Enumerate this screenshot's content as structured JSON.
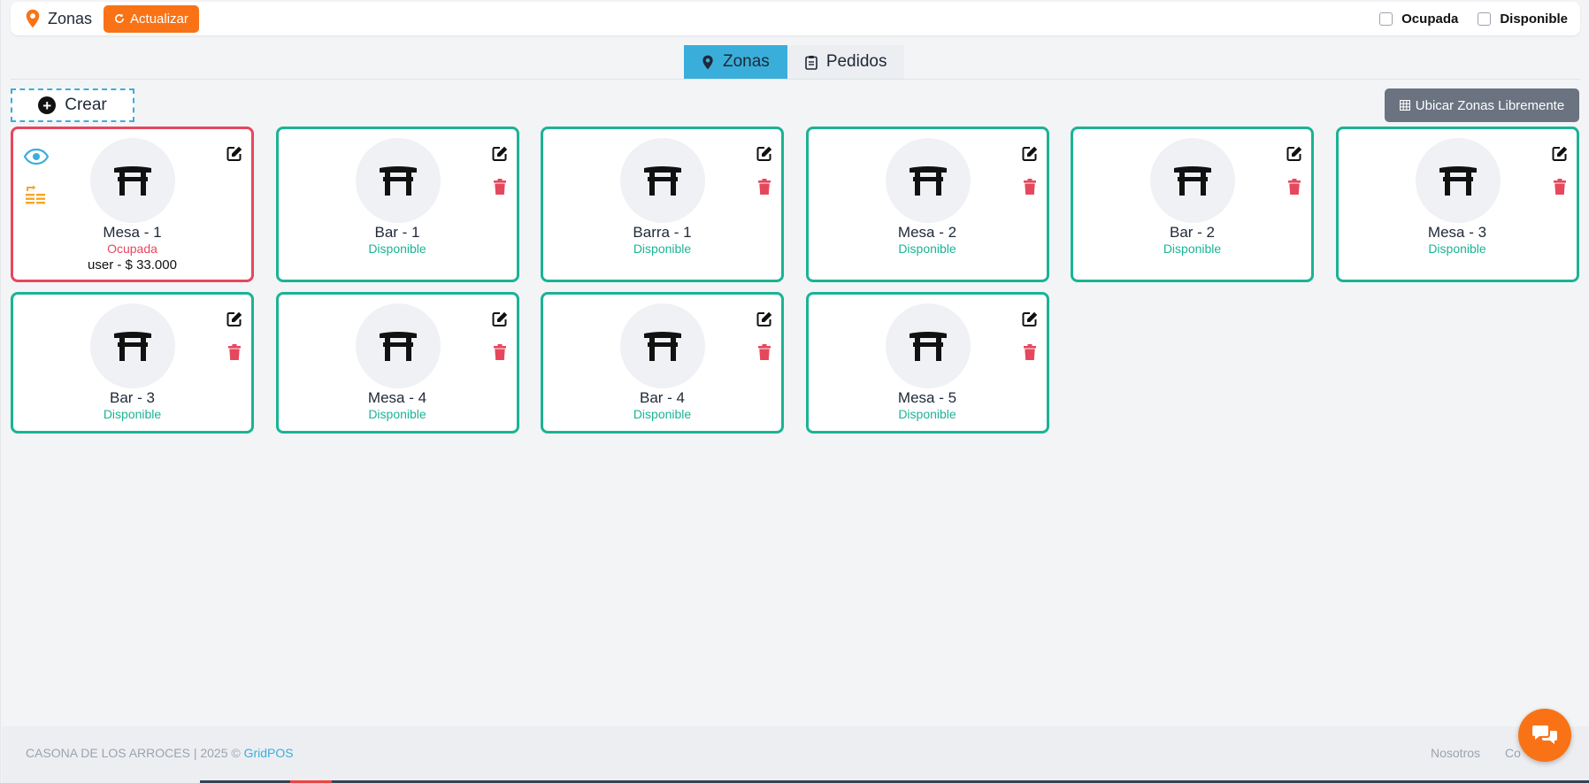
{
  "header": {
    "title": "Zonas",
    "refresh_label": "Actualizar",
    "filters": [
      {
        "label": "Ocupada",
        "checked": false
      },
      {
        "label": "Disponible",
        "checked": false
      }
    ]
  },
  "tabs": [
    {
      "label": "Zonas",
      "active": true
    },
    {
      "label": "Pedidos",
      "active": false
    }
  ],
  "actions": {
    "create_label": "Crear",
    "locate_label": "Ubicar Zonas Libremente"
  },
  "zones": [
    {
      "name": "Mesa - 1",
      "status": "Ocupada",
      "order": "user - $ 33.000"
    },
    {
      "name": "Bar - 1",
      "status": "Disponible"
    },
    {
      "name": "Barra - 1",
      "status": "Disponible"
    },
    {
      "name": "Mesa - 2",
      "status": "Disponible"
    },
    {
      "name": "Bar - 2",
      "status": "Disponible"
    },
    {
      "name": "Mesa - 3",
      "status": "Disponible"
    },
    {
      "name": "Bar - 3",
      "status": "Disponible"
    },
    {
      "name": "Mesa - 4",
      "status": "Disponible"
    },
    {
      "name": "Bar - 4",
      "status": "Disponible"
    },
    {
      "name": "Mesa - 5",
      "status": "Disponible"
    }
  ],
  "footer": {
    "copyright": "CASONA DE LOS ARROCES | 2025 ©",
    "brand_link": "GridPOS",
    "links": [
      "Nosotros",
      "Co"
    ]
  },
  "colors": {
    "accent": "#3aaedb",
    "orange": "#f97316",
    "available": "#1bb394",
    "occupied": "#e5485d"
  }
}
